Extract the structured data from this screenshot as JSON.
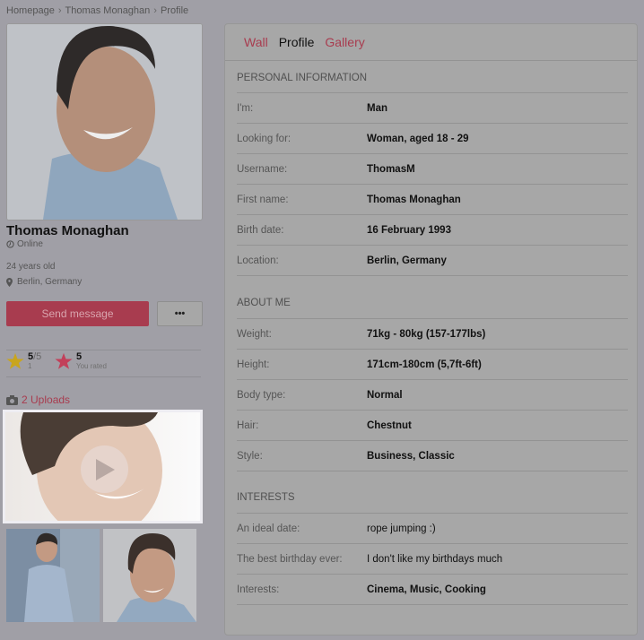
{
  "breadcrumb": [
    "Homepage",
    "Thomas Monaghan",
    "Profile"
  ],
  "profile": {
    "name": "Thomas Monaghan",
    "status": "Online",
    "age": "24 years old",
    "location": "Berlin, Germany",
    "send_message_label": "Send message",
    "more_label": "•••"
  },
  "ratings": {
    "average": {
      "value": "5",
      "max": "/5",
      "count": "1"
    },
    "user": {
      "value": "5",
      "label": "You rated"
    }
  },
  "uploads": {
    "label": "2 Uploads"
  },
  "tabs": [
    {
      "label": "Wall",
      "active": false
    },
    {
      "label": "Profile",
      "active": true
    },
    {
      "label": "Gallery",
      "active": false
    }
  ],
  "sections": [
    {
      "title": "PERSONAL INFORMATION",
      "rows": [
        {
          "label": "I'm:",
          "value": "Man"
        },
        {
          "label": "Looking for:",
          "value": "Woman, aged 18 - 29"
        },
        {
          "label": "Username:",
          "value": "ThomasM"
        },
        {
          "label": "First name:",
          "value": "Thomas Monaghan"
        },
        {
          "label": "Birth date:",
          "value": "16 February 1993"
        },
        {
          "label": "Location:",
          "value": "Berlin, Germany"
        }
      ]
    },
    {
      "title": "ABOUT ME",
      "rows": [
        {
          "label": "Weight:",
          "value": "71kg - 80kg (157-177lbs)"
        },
        {
          "label": "Height:",
          "value": "171cm-180cm (5,7ft-6ft)"
        },
        {
          "label": "Body type:",
          "value": "Normal"
        },
        {
          "label": "Hair:",
          "value": "Chestnut"
        },
        {
          "label": "Style:",
          "value": "Business, Classic"
        }
      ]
    },
    {
      "title": "INTERESTS",
      "rows": [
        {
          "label": "An ideal date:",
          "value": "rope jumping :)"
        },
        {
          "label": "The best birthday ever:",
          "value": "I don't like my birthdays much"
        },
        {
          "label": "Interests:",
          "value": "Cinema, Music, Cooking"
        }
      ]
    }
  ],
  "colors": {
    "accent": "#a83c4f",
    "overlay_bg": "#a09fa6",
    "star_gold": "#c9a51d",
    "star_red": "#c2405a"
  }
}
